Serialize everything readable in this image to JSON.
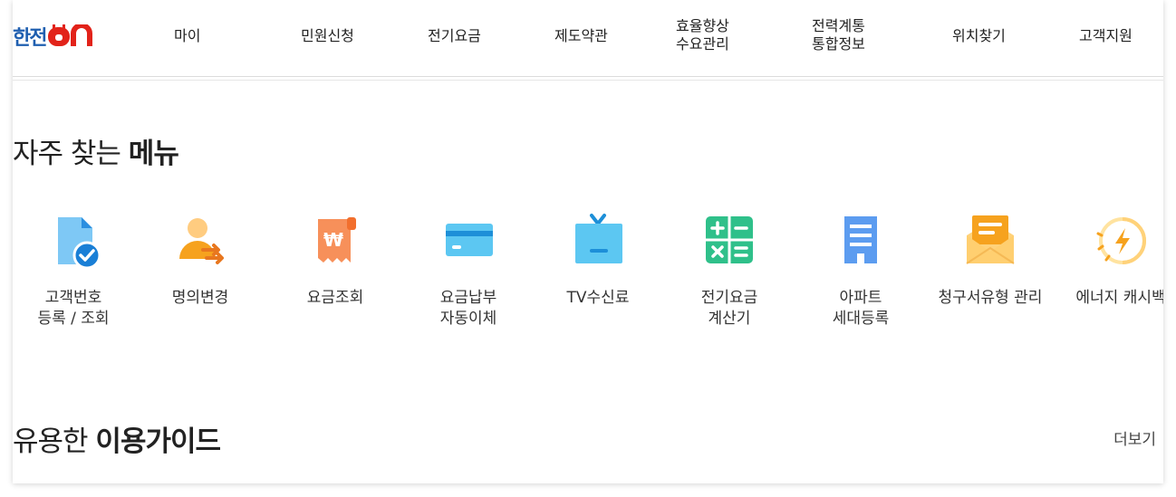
{
  "logo": {
    "text_han": "한전",
    "text_on": "ON"
  },
  "nav": [
    {
      "label": "마이"
    },
    {
      "label": "민원신청"
    },
    {
      "label": "전기요금"
    },
    {
      "label": "제도약관"
    },
    {
      "label": "효율향상\n수요관리"
    },
    {
      "label": "전력계통\n통합정보"
    },
    {
      "label": "위치찾기"
    },
    {
      "label": "고객지원"
    }
  ],
  "quick_menu": {
    "title_regular": "자주 찾는 ",
    "title_bold": "메뉴",
    "items": [
      {
        "label": "고객번호\n등록 / 조회",
        "icon": "customer-number-icon"
      },
      {
        "label": "명의변경",
        "icon": "name-change-icon"
      },
      {
        "label": "요금조회",
        "icon": "bill-inquiry-icon"
      },
      {
        "label": "요금납부\n자동이체",
        "icon": "card-payment-icon"
      },
      {
        "label": "TV수신료",
        "icon": "tv-icon"
      },
      {
        "label": "전기요금\n계산기",
        "icon": "calculator-icon"
      },
      {
        "label": "아파트\n세대등록",
        "icon": "apartment-icon"
      },
      {
        "label": "청구서유형 관리",
        "icon": "envelope-icon"
      },
      {
        "label": "에너지 캐시백",
        "icon": "energy-cashback-icon"
      }
    ]
  },
  "guide": {
    "title_regular": "유용한 ",
    "title_bold": "이용가이드",
    "more_label": "더보기"
  },
  "colors": {
    "brand_blue": "#1f5fb0",
    "brand_red": "#e2231a"
  }
}
